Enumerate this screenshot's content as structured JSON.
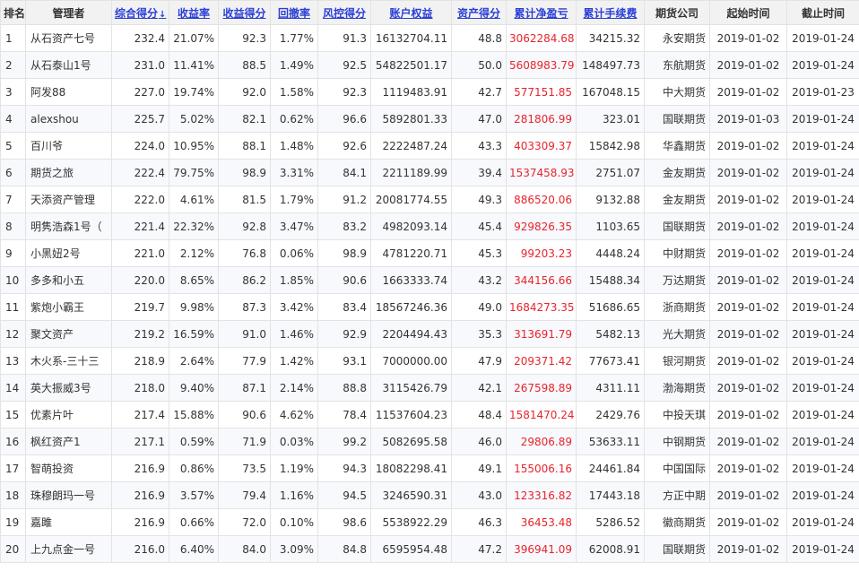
{
  "headers": [
    {
      "label": "排名",
      "sortable": false,
      "name": "header-rank"
    },
    {
      "label": "管理者",
      "sortable": false,
      "name": "header-manager"
    },
    {
      "label": "综合得分",
      "sortable": true,
      "active": true,
      "arrow": "↓",
      "name": "header-composite-score"
    },
    {
      "label": "收益率",
      "sortable": true,
      "name": "header-return-rate"
    },
    {
      "label": "收益得分",
      "sortable": true,
      "name": "header-return-score"
    },
    {
      "label": "回撤率",
      "sortable": true,
      "name": "header-drawdown"
    },
    {
      "label": "风控得分",
      "sortable": true,
      "name": "header-risk-score"
    },
    {
      "label": "账户权益",
      "sortable": true,
      "name": "header-equity"
    },
    {
      "label": "资产得分",
      "sortable": true,
      "name": "header-asset-score"
    },
    {
      "label": "累计净盈亏",
      "sortable": true,
      "name": "header-net-pnl"
    },
    {
      "label": "累计手续费",
      "sortable": true,
      "name": "header-fees"
    },
    {
      "label": "期货公司",
      "sortable": false,
      "name": "header-broker"
    },
    {
      "label": "起始时间",
      "sortable": false,
      "name": "header-start"
    },
    {
      "label": "截止时间",
      "sortable": false,
      "name": "header-end"
    }
  ],
  "rows": [
    {
      "rank": "1",
      "manager": "从石资产七号",
      "score": "232.4",
      "return_rate": "21.07%",
      "return_score": "92.3",
      "drawdown": "1.77%",
      "risk_score": "91.3",
      "equity": "16132704.11",
      "asset_score": "48.8",
      "net_pnl": "3062284.68",
      "fees": "34215.32",
      "broker": "永安期货",
      "start": "2019-01-02",
      "end": "2019-01-24"
    },
    {
      "rank": "2",
      "manager": "从石泰山1号",
      "score": "231.0",
      "return_rate": "11.41%",
      "return_score": "88.5",
      "drawdown": "1.49%",
      "risk_score": "92.5",
      "equity": "54822501.17",
      "asset_score": "50.0",
      "net_pnl": "5608983.79",
      "fees": "148497.73",
      "broker": "东航期货",
      "start": "2019-01-02",
      "end": "2019-01-24"
    },
    {
      "rank": "3",
      "manager": "阿发88",
      "score": "227.0",
      "return_rate": "19.74%",
      "return_score": "92.0",
      "drawdown": "1.58%",
      "risk_score": "92.3",
      "equity": "1119483.91",
      "asset_score": "42.7",
      "net_pnl": "577151.85",
      "fees": "167048.15",
      "broker": "中大期货",
      "start": "2019-01-02",
      "end": "2019-01-23"
    },
    {
      "rank": "4",
      "manager": "alexshou",
      "score": "225.7",
      "return_rate": "5.02%",
      "return_score": "82.1",
      "drawdown": "0.62%",
      "risk_score": "96.6",
      "equity": "5892801.33",
      "asset_score": "47.0",
      "net_pnl": "281806.99",
      "fees": "323.01",
      "broker": "国联期货",
      "start": "2019-01-03",
      "end": "2019-01-24"
    },
    {
      "rank": "5",
      "manager": "百川爷",
      "score": "224.0",
      "return_rate": "10.95%",
      "return_score": "88.1",
      "drawdown": "1.48%",
      "risk_score": "92.6",
      "equity": "2222487.24",
      "asset_score": "43.3",
      "net_pnl": "403309.37",
      "fees": "15842.98",
      "broker": "华鑫期货",
      "start": "2019-01-02",
      "end": "2019-01-24"
    },
    {
      "rank": "6",
      "manager": "期货之旅",
      "score": "222.4",
      "return_rate": "79.75%",
      "return_score": "98.9",
      "drawdown": "3.31%",
      "risk_score": "84.1",
      "equity": "2211189.99",
      "asset_score": "39.4",
      "net_pnl": "1537458.93",
      "fees": "2751.07",
      "broker": "金友期货",
      "start": "2019-01-02",
      "end": "2019-01-24"
    },
    {
      "rank": "7",
      "manager": "天添资产管理",
      "score": "222.0",
      "return_rate": "4.61%",
      "return_score": "81.5",
      "drawdown": "1.79%",
      "risk_score": "91.2",
      "equity": "20081774.55",
      "asset_score": "49.3",
      "net_pnl": "886520.06",
      "fees": "9132.88",
      "broker": "金友期货",
      "start": "2019-01-02",
      "end": "2019-01-24"
    },
    {
      "rank": "8",
      "manager": "明隽浩森1号（",
      "score": "221.4",
      "return_rate": "22.32%",
      "return_score": "92.8",
      "drawdown": "3.47%",
      "risk_score": "83.2",
      "equity": "4982093.14",
      "asset_score": "45.4",
      "net_pnl": "929826.35",
      "fees": "1103.65",
      "broker": "国联期货",
      "start": "2019-01-02",
      "end": "2019-01-24"
    },
    {
      "rank": "9",
      "manager": "小黑妞2号",
      "score": "221.0",
      "return_rate": "2.12%",
      "return_score": "76.8",
      "drawdown": "0.06%",
      "risk_score": "98.9",
      "equity": "4781220.71",
      "asset_score": "45.3",
      "net_pnl": "99203.23",
      "fees": "4448.24",
      "broker": "中财期货",
      "start": "2019-01-02",
      "end": "2019-01-24"
    },
    {
      "rank": "10",
      "manager": "多多和小五",
      "score": "220.0",
      "return_rate": "8.65%",
      "return_score": "86.2",
      "drawdown": "1.85%",
      "risk_score": "90.6",
      "equity": "1663333.74",
      "asset_score": "43.2",
      "net_pnl": "344156.66",
      "fees": "15488.34",
      "broker": "万达期货",
      "start": "2019-01-02",
      "end": "2019-01-24"
    },
    {
      "rank": "11",
      "manager": "紫炮小霸王",
      "score": "219.7",
      "return_rate": "9.98%",
      "return_score": "87.3",
      "drawdown": "3.42%",
      "risk_score": "83.4",
      "equity": "18567246.36",
      "asset_score": "49.0",
      "net_pnl": "1684273.35",
      "fees": "51686.65",
      "broker": "浙商期货",
      "start": "2019-01-02",
      "end": "2019-01-24"
    },
    {
      "rank": "12",
      "manager": "聚文资产",
      "score": "219.2",
      "return_rate": "16.59%",
      "return_score": "91.0",
      "drawdown": "1.46%",
      "risk_score": "92.9",
      "equity": "2204494.43",
      "asset_score": "35.3",
      "net_pnl": "313691.79",
      "fees": "5482.13",
      "broker": "光大期货",
      "start": "2019-01-02",
      "end": "2019-01-24"
    },
    {
      "rank": "13",
      "manager": "木火系-三十三",
      "score": "218.9",
      "return_rate": "2.64%",
      "return_score": "77.9",
      "drawdown": "1.42%",
      "risk_score": "93.1",
      "equity": "7000000.00",
      "asset_score": "47.9",
      "net_pnl": "209371.42",
      "fees": "77673.41",
      "broker": "银河期货",
      "start": "2019-01-02",
      "end": "2019-01-24"
    },
    {
      "rank": "14",
      "manager": "英大振威3号",
      "score": "218.0",
      "return_rate": "9.40%",
      "return_score": "87.1",
      "drawdown": "2.14%",
      "risk_score": "88.8",
      "equity": "3115426.79",
      "asset_score": "42.1",
      "net_pnl": "267598.89",
      "fees": "4311.11",
      "broker": "渤海期货",
      "start": "2019-01-02",
      "end": "2019-01-24"
    },
    {
      "rank": "15",
      "manager": "优素片叶",
      "score": "217.4",
      "return_rate": "15.88%",
      "return_score": "90.6",
      "drawdown": "4.62%",
      "risk_score": "78.4",
      "equity": "11537604.23",
      "asset_score": "48.4",
      "net_pnl": "1581470.24",
      "fees": "2429.76",
      "broker": "中投天琪",
      "start": "2019-01-02",
      "end": "2019-01-24"
    },
    {
      "rank": "16",
      "manager": "枫红资产1",
      "score": "217.1",
      "return_rate": "0.59%",
      "return_score": "71.9",
      "drawdown": "0.03%",
      "risk_score": "99.2",
      "equity": "5082695.58",
      "asset_score": "46.0",
      "net_pnl": "29806.89",
      "fees": "53633.11",
      "broker": "中钢期货",
      "start": "2019-01-02",
      "end": "2019-01-24"
    },
    {
      "rank": "17",
      "manager": "智萌投资",
      "score": "216.9",
      "return_rate": "0.86%",
      "return_score": "73.5",
      "drawdown": "1.19%",
      "risk_score": "94.3",
      "equity": "18082298.41",
      "asset_score": "49.1",
      "net_pnl": "155006.16",
      "fees": "24461.84",
      "broker": "中国国际",
      "start": "2019-01-02",
      "end": "2019-01-24"
    },
    {
      "rank": "18",
      "manager": "珠穆朗玛一号",
      "score": "216.9",
      "return_rate": "3.57%",
      "return_score": "79.4",
      "drawdown": "1.16%",
      "risk_score": "94.5",
      "equity": "3246590.31",
      "asset_score": "43.0",
      "net_pnl": "123316.82",
      "fees": "17443.18",
      "broker": "方正中期",
      "start": "2019-01-02",
      "end": "2019-01-24"
    },
    {
      "rank": "19",
      "manager": "嘉雎",
      "score": "216.9",
      "return_rate": "0.66%",
      "return_score": "72.0",
      "drawdown": "0.10%",
      "risk_score": "98.6",
      "equity": "5538922.29",
      "asset_score": "46.3",
      "net_pnl": "36453.48",
      "fees": "5286.52",
      "broker": "徽商期货",
      "start": "2019-01-02",
      "end": "2019-01-24"
    },
    {
      "rank": "20",
      "manager": "上九点金一号",
      "score": "216.0",
      "return_rate": "6.40%",
      "return_score": "84.0",
      "drawdown": "3.09%",
      "risk_score": "84.8",
      "equity": "6595954.48",
      "asset_score": "47.2",
      "net_pnl": "396941.09",
      "fees": "62008.91",
      "broker": "国联期货",
      "start": "2019-01-02",
      "end": "2019-01-24"
    }
  ]
}
